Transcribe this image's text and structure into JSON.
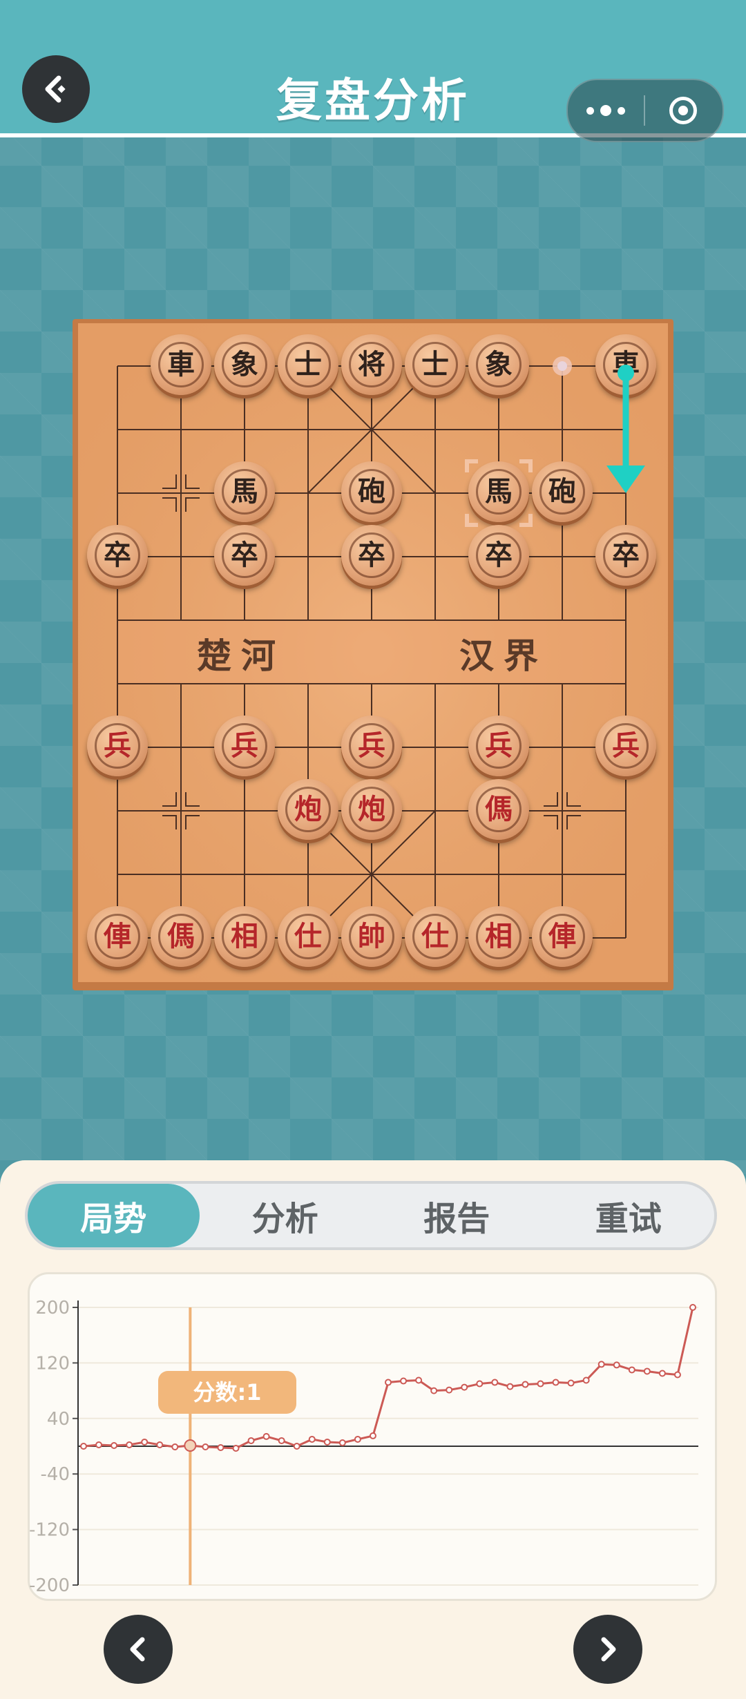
{
  "header": {
    "title": "复盘分析"
  },
  "board": {
    "river_left": "楚河",
    "river_right": "汉界",
    "pieces": [
      {
        "side": "black",
        "label": "車",
        "col": 1,
        "row": 0
      },
      {
        "side": "black",
        "label": "象",
        "col": 2,
        "row": 0
      },
      {
        "side": "black",
        "label": "士",
        "col": 3,
        "row": 0
      },
      {
        "side": "black",
        "label": "将",
        "col": 4,
        "row": 0
      },
      {
        "side": "black",
        "label": "士",
        "col": 5,
        "row": 0
      },
      {
        "side": "black",
        "label": "象",
        "col": 6,
        "row": 0
      },
      {
        "side": "black",
        "label": "車",
        "col": 8,
        "row": 0
      },
      {
        "side": "black",
        "label": "馬",
        "col": 2,
        "row": 2
      },
      {
        "side": "black",
        "label": "砲",
        "col": 4,
        "row": 2
      },
      {
        "side": "black",
        "label": "馬",
        "col": 6,
        "row": 2
      },
      {
        "side": "black",
        "label": "砲",
        "col": 7,
        "row": 2
      },
      {
        "side": "black",
        "label": "卒",
        "col": 0,
        "row": 3
      },
      {
        "side": "black",
        "label": "卒",
        "col": 2,
        "row": 3
      },
      {
        "side": "black",
        "label": "卒",
        "col": 4,
        "row": 3
      },
      {
        "side": "black",
        "label": "卒",
        "col": 6,
        "row": 3
      },
      {
        "side": "black",
        "label": "卒",
        "col": 8,
        "row": 3
      },
      {
        "side": "red",
        "label": "兵",
        "col": 0,
        "row": 6
      },
      {
        "side": "red",
        "label": "兵",
        "col": 2,
        "row": 6
      },
      {
        "side": "red",
        "label": "兵",
        "col": 4,
        "row": 6
      },
      {
        "side": "red",
        "label": "兵",
        "col": 6,
        "row": 6
      },
      {
        "side": "red",
        "label": "兵",
        "col": 8,
        "row": 6
      },
      {
        "side": "red",
        "label": "炮",
        "col": 3,
        "row": 7
      },
      {
        "side": "red",
        "label": "炮",
        "col": 4,
        "row": 7
      },
      {
        "side": "red",
        "label": "傌",
        "col": 6,
        "row": 7
      },
      {
        "side": "red",
        "label": "俥",
        "col": 0,
        "row": 9
      },
      {
        "side": "red",
        "label": "傌",
        "col": 1,
        "row": 9
      },
      {
        "side": "red",
        "label": "相",
        "col": 2,
        "row": 9
      },
      {
        "side": "red",
        "label": "仕",
        "col": 3,
        "row": 9
      },
      {
        "side": "red",
        "label": "帥",
        "col": 4,
        "row": 9
      },
      {
        "side": "red",
        "label": "仕",
        "col": 5,
        "row": 9
      },
      {
        "side": "red",
        "label": "相",
        "col": 6,
        "row": 9
      },
      {
        "side": "red",
        "label": "俥",
        "col": 7,
        "row": 9
      }
    ],
    "last_move": {
      "from": {
        "col": 7,
        "row": 0
      },
      "to_piece": {
        "col": 8,
        "row": 0
      },
      "arrow_from": {
        "col": 8,
        "row": 0
      },
      "arrow_to": {
        "col": 8,
        "row": 2
      }
    },
    "highlight": {
      "col": 6,
      "row": 2
    },
    "colors": {
      "board": "#e8a36b",
      "line": "#4a2e22",
      "arrow": "#1fd0c4"
    }
  },
  "tabs": [
    {
      "label": "局势",
      "active": true
    },
    {
      "label": "分析",
      "active": false
    },
    {
      "label": "报告",
      "active": false
    },
    {
      "label": "重试",
      "active": false
    }
  ],
  "chart_data": {
    "type": "line",
    "yticks": [
      "200",
      "120",
      "40",
      "-40",
      "-120",
      "-200"
    ],
    "ylim": [
      -200,
      200
    ],
    "tooltip": "分数:1",
    "cursor_index": 7,
    "values": [
      0,
      2,
      1,
      2,
      6,
      2,
      -1,
      1,
      -1,
      -2,
      -3,
      8,
      14,
      8,
      0,
      10,
      6,
      5,
      10,
      15,
      92,
      94,
      95,
      80,
      81,
      85,
      90,
      92,
      86,
      89,
      90,
      92,
      91,
      95,
      118,
      117,
      110,
      108,
      105,
      103,
      200
    ],
    "color": "#cc5a55"
  }
}
